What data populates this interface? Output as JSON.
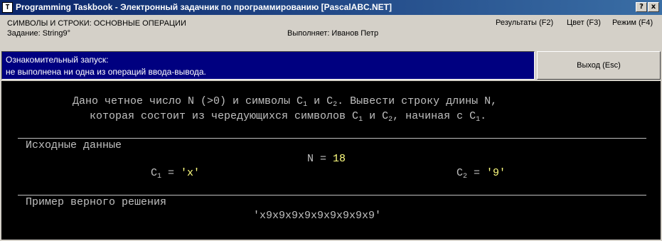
{
  "window": {
    "icon_label": "T",
    "title": "Programming Taskbook - Электронный задачник по программированию [PascalABC.NET]",
    "help_button": "?",
    "close_button": "x"
  },
  "header": {
    "group_title": "СИМВОЛЫ И СТРОКИ: ОСНОВНЫЕ ОПЕРАЦИИ",
    "task_label": "Задание: String9°",
    "performer_label": "Выполняет: Иванов Петр",
    "results_button": "Результаты (F2)",
    "color_button": "Цвет (F3)",
    "mode_button": "Режим (F4)"
  },
  "status": {
    "line1": "Ознакомительный запуск:",
    "line2": " не выполнена ни одна из операций ввода-вывода.",
    "exit_button": "Выход (Esc)"
  },
  "task": {
    "line1_a": "Дано четное число N (>0) и символы C",
    "line1_sub1": "1",
    "line1_b": " и C",
    "line1_sub2": "2",
    "line1_c": ". Вывести строку длины N,",
    "line2_a": "которая состоит из чередующихся символов C",
    "line2_sub1": "1",
    "line2_b": " и C",
    "line2_sub2": "2",
    "line2_c": ", начиная с C",
    "line2_sub3": "1",
    "line2_d": "."
  },
  "input_section": {
    "heading": "Исходные данные",
    "n_label": "N = ",
    "n_value": "18",
    "c1_label": "C",
    "c1_sub": "1",
    "c1_eq": " = ",
    "c1_value": "'x'",
    "c2_label": "C",
    "c2_sub": "2",
    "c2_eq": " = ",
    "c2_value": "'9'"
  },
  "example_section": {
    "heading": "Пример верного решения",
    "result": "'x9x9x9x9x9x9x9x9x9'"
  }
}
